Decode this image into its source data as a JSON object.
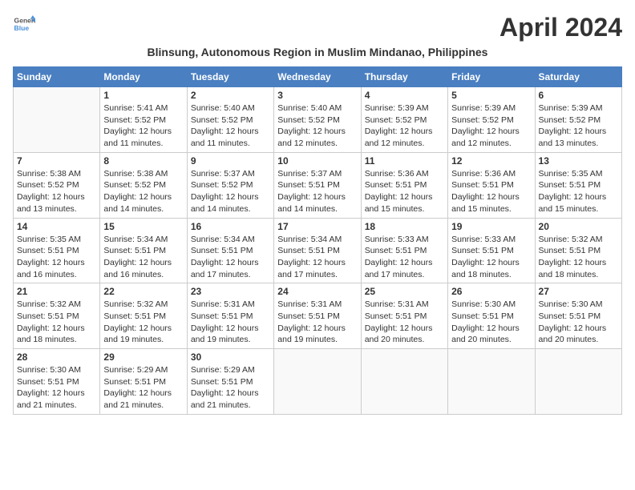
{
  "header": {
    "logo_line1": "General",
    "logo_line2": "Blue",
    "month_title": "April 2024",
    "subtitle": "Blinsung, Autonomous Region in Muslim Mindanao, Philippines"
  },
  "weekdays": [
    "Sunday",
    "Monday",
    "Tuesday",
    "Wednesday",
    "Thursday",
    "Friday",
    "Saturday"
  ],
  "weeks": [
    [
      {
        "day": "",
        "info": ""
      },
      {
        "day": "1",
        "info": "Sunrise: 5:41 AM\nSunset: 5:52 PM\nDaylight: 12 hours\nand 11 minutes."
      },
      {
        "day": "2",
        "info": "Sunrise: 5:40 AM\nSunset: 5:52 PM\nDaylight: 12 hours\nand 11 minutes."
      },
      {
        "day": "3",
        "info": "Sunrise: 5:40 AM\nSunset: 5:52 PM\nDaylight: 12 hours\nand 12 minutes."
      },
      {
        "day": "4",
        "info": "Sunrise: 5:39 AM\nSunset: 5:52 PM\nDaylight: 12 hours\nand 12 minutes."
      },
      {
        "day": "5",
        "info": "Sunrise: 5:39 AM\nSunset: 5:52 PM\nDaylight: 12 hours\nand 12 minutes."
      },
      {
        "day": "6",
        "info": "Sunrise: 5:39 AM\nSunset: 5:52 PM\nDaylight: 12 hours\nand 13 minutes."
      }
    ],
    [
      {
        "day": "7",
        "info": "Sunrise: 5:38 AM\nSunset: 5:52 PM\nDaylight: 12 hours\nand 13 minutes."
      },
      {
        "day": "8",
        "info": "Sunrise: 5:38 AM\nSunset: 5:52 PM\nDaylight: 12 hours\nand 14 minutes."
      },
      {
        "day": "9",
        "info": "Sunrise: 5:37 AM\nSunset: 5:52 PM\nDaylight: 12 hours\nand 14 minutes."
      },
      {
        "day": "10",
        "info": "Sunrise: 5:37 AM\nSunset: 5:51 PM\nDaylight: 12 hours\nand 14 minutes."
      },
      {
        "day": "11",
        "info": "Sunrise: 5:36 AM\nSunset: 5:51 PM\nDaylight: 12 hours\nand 15 minutes."
      },
      {
        "day": "12",
        "info": "Sunrise: 5:36 AM\nSunset: 5:51 PM\nDaylight: 12 hours\nand 15 minutes."
      },
      {
        "day": "13",
        "info": "Sunrise: 5:35 AM\nSunset: 5:51 PM\nDaylight: 12 hours\nand 15 minutes."
      }
    ],
    [
      {
        "day": "14",
        "info": "Sunrise: 5:35 AM\nSunset: 5:51 PM\nDaylight: 12 hours\nand 16 minutes."
      },
      {
        "day": "15",
        "info": "Sunrise: 5:34 AM\nSunset: 5:51 PM\nDaylight: 12 hours\nand 16 minutes."
      },
      {
        "day": "16",
        "info": "Sunrise: 5:34 AM\nSunset: 5:51 PM\nDaylight: 12 hours\nand 17 minutes."
      },
      {
        "day": "17",
        "info": "Sunrise: 5:34 AM\nSunset: 5:51 PM\nDaylight: 12 hours\nand 17 minutes."
      },
      {
        "day": "18",
        "info": "Sunrise: 5:33 AM\nSunset: 5:51 PM\nDaylight: 12 hours\nand 17 minutes."
      },
      {
        "day": "19",
        "info": "Sunrise: 5:33 AM\nSunset: 5:51 PM\nDaylight: 12 hours\nand 18 minutes."
      },
      {
        "day": "20",
        "info": "Sunrise: 5:32 AM\nSunset: 5:51 PM\nDaylight: 12 hours\nand 18 minutes."
      }
    ],
    [
      {
        "day": "21",
        "info": "Sunrise: 5:32 AM\nSunset: 5:51 PM\nDaylight: 12 hours\nand 18 minutes."
      },
      {
        "day": "22",
        "info": "Sunrise: 5:32 AM\nSunset: 5:51 PM\nDaylight: 12 hours\nand 19 minutes."
      },
      {
        "day": "23",
        "info": "Sunrise: 5:31 AM\nSunset: 5:51 PM\nDaylight: 12 hours\nand 19 minutes."
      },
      {
        "day": "24",
        "info": "Sunrise: 5:31 AM\nSunset: 5:51 PM\nDaylight: 12 hours\nand 19 minutes."
      },
      {
        "day": "25",
        "info": "Sunrise: 5:31 AM\nSunset: 5:51 PM\nDaylight: 12 hours\nand 20 minutes."
      },
      {
        "day": "26",
        "info": "Sunrise: 5:30 AM\nSunset: 5:51 PM\nDaylight: 12 hours\nand 20 minutes."
      },
      {
        "day": "27",
        "info": "Sunrise: 5:30 AM\nSunset: 5:51 PM\nDaylight: 12 hours\nand 20 minutes."
      }
    ],
    [
      {
        "day": "28",
        "info": "Sunrise: 5:30 AM\nSunset: 5:51 PM\nDaylight: 12 hours\nand 21 minutes."
      },
      {
        "day": "29",
        "info": "Sunrise: 5:29 AM\nSunset: 5:51 PM\nDaylight: 12 hours\nand 21 minutes."
      },
      {
        "day": "30",
        "info": "Sunrise: 5:29 AM\nSunset: 5:51 PM\nDaylight: 12 hours\nand 21 minutes."
      },
      {
        "day": "",
        "info": ""
      },
      {
        "day": "",
        "info": ""
      },
      {
        "day": "",
        "info": ""
      },
      {
        "day": "",
        "info": ""
      }
    ]
  ]
}
